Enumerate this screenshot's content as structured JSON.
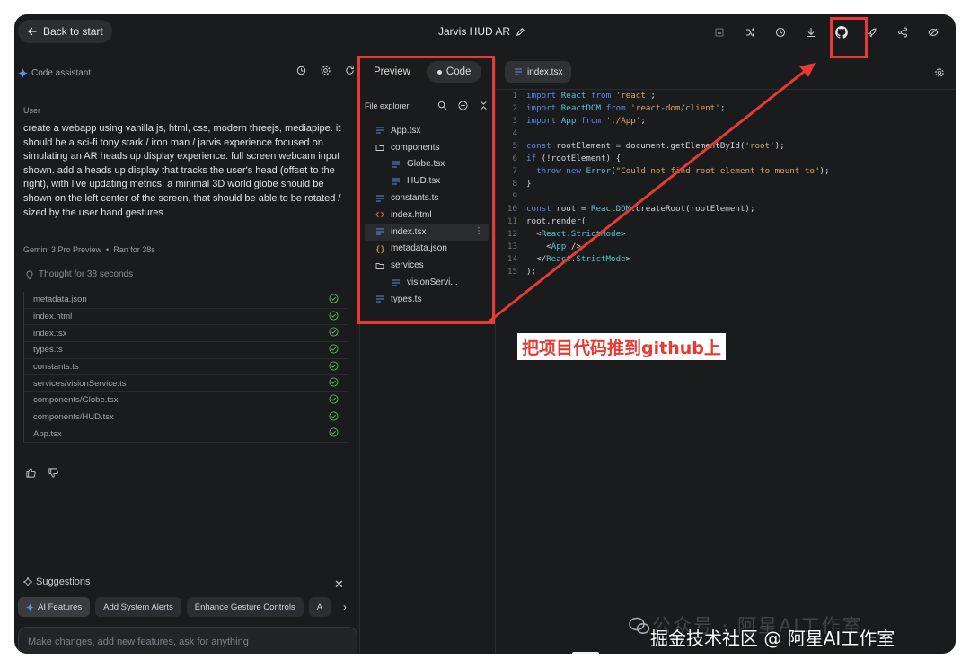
{
  "header": {
    "back_label": "Back to start",
    "project_title": "Jarvis HUD AR",
    "icons": [
      "save-icon",
      "branch-icon",
      "history-icon",
      "download-icon",
      "github-icon",
      "deploy-rocket-icon",
      "share-icon",
      "hide-icon"
    ]
  },
  "assistant": {
    "title": "Code assistant",
    "user_label": "User",
    "prompt": "create a webapp using vanilla js,   html,   css,   modern threejs, mediapipe. it should be a sci-fi tony stark / iron man / jarvis experience focused on simulating an AR heads up display experience. full screen webcam input shown. add a heads up display that tracks the user's head (offset to the right),   with live updating metrics. a minimal 3D world globe should be shown on the left center of the screen,   that should be able to be rotated / sized by the user hand gestures",
    "model": "Gemini 3 Pro Preview",
    "run_time": "Ran for 38s",
    "thought": "Thought for 38 seconds",
    "files": [
      "metadata.json",
      "index.html",
      "index.tsx",
      "types.ts",
      "constants.ts",
      "services/visionService.ts",
      "components/Globe.tsx",
      "components/HUD.tsx",
      "App.tsx"
    ]
  },
  "suggestions": {
    "title": "Suggestions",
    "chips": [
      "AI Features",
      "Add System Alerts",
      "Enhance Gesture Controls",
      "A"
    ]
  },
  "chat_input": {
    "placeholder": "Make changes, add new features, ask for anything"
  },
  "panel_tabs": {
    "preview": "Preview",
    "code": "Code"
  },
  "file_explorer": {
    "title": "File explorer",
    "items": [
      {
        "name": "App.tsx",
        "type": "file",
        "indent": false
      },
      {
        "name": "components",
        "type": "folder",
        "indent": false
      },
      {
        "name": "Globe.tsx",
        "type": "file",
        "indent": true
      },
      {
        "name": "HUD.tsx",
        "type": "file",
        "indent": true
      },
      {
        "name": "constants.ts",
        "type": "file",
        "indent": false
      },
      {
        "name": "index.html",
        "type": "html",
        "indent": false
      },
      {
        "name": "index.tsx",
        "type": "file",
        "indent": false,
        "selected": true
      },
      {
        "name": "metadata.json",
        "type": "json",
        "indent": false
      },
      {
        "name": "services",
        "type": "folder",
        "indent": false
      },
      {
        "name": "visionServi...",
        "type": "file",
        "indent": true
      },
      {
        "name": "types.ts",
        "type": "file",
        "indent": false
      }
    ]
  },
  "editor": {
    "tab": "index.tsx",
    "lines": [
      [
        [
          "kw",
          "import"
        ],
        [
          "t",
          " "
        ],
        [
          "id",
          "React"
        ],
        [
          "t",
          " "
        ],
        [
          "kw",
          "from"
        ],
        [
          "t",
          " "
        ],
        [
          "str",
          "'react'"
        ],
        [
          "t",
          ";"
        ]
      ],
      [
        [
          "kw",
          "import"
        ],
        [
          "t",
          " "
        ],
        [
          "id",
          "ReactDOM"
        ],
        [
          "t",
          " "
        ],
        [
          "kw",
          "from"
        ],
        [
          "t",
          " "
        ],
        [
          "str",
          "'react-dom/client'"
        ],
        [
          "t",
          ";"
        ]
      ],
      [
        [
          "kw",
          "import"
        ],
        [
          "t",
          " "
        ],
        [
          "id",
          "App"
        ],
        [
          "t",
          " "
        ],
        [
          "kw",
          "from"
        ],
        [
          "t",
          " "
        ],
        [
          "str",
          "'./App'"
        ],
        [
          "t",
          ";"
        ]
      ],
      [],
      [
        [
          "kw",
          "const"
        ],
        [
          "t",
          " rootElement = document.getElementById("
        ],
        [
          "str",
          "'root'"
        ],
        [
          "t",
          ");"
        ]
      ],
      [
        [
          "kw",
          "if"
        ],
        [
          "t",
          " (!rootElement) {"
        ]
      ],
      [
        [
          "t",
          "  "
        ],
        [
          "kw",
          "throw"
        ],
        [
          "t",
          " "
        ],
        [
          "kw",
          "new"
        ],
        [
          "t",
          " "
        ],
        [
          "id",
          "Error"
        ],
        [
          "t",
          "("
        ],
        [
          "str",
          "\"Could not find root element to mount to\""
        ],
        [
          "t",
          ");"
        ]
      ],
      [
        [
          "t",
          "}"
        ]
      ],
      [],
      [
        [
          "kw",
          "const"
        ],
        [
          "t",
          " root = "
        ],
        [
          "id",
          "ReactDOM"
        ],
        [
          "t",
          ".createRoot(rootElement);"
        ]
      ],
      [
        [
          "t",
          "root.render("
        ]
      ],
      [
        [
          "t",
          "  <"
        ],
        [
          "id",
          "React.StrictMode"
        ],
        [
          "t",
          ">"
        ]
      ],
      [
        [
          "t",
          "    <"
        ],
        [
          "id",
          "App"
        ],
        [
          "t",
          " />"
        ]
      ],
      [
        [
          "t",
          "  </"
        ],
        [
          "id",
          "React.StrictMode"
        ],
        [
          "t",
          ">"
        ]
      ],
      [
        [
          "t",
          ");"
        ]
      ]
    ]
  },
  "annotation": {
    "label": "把项目代码推到github上"
  },
  "watermark": {
    "ghost": "公众号 · 阿星AI工作室",
    "main": "掘金技术社区 @ 阿星AI工作室"
  },
  "colors": {
    "background": "#1a1b1d",
    "annotation_red": "#e63a32",
    "keyword": "#5b8cf0",
    "string": "#d9a66c",
    "identifier": "#56c2d6",
    "success_green": "#5cb85c"
  }
}
